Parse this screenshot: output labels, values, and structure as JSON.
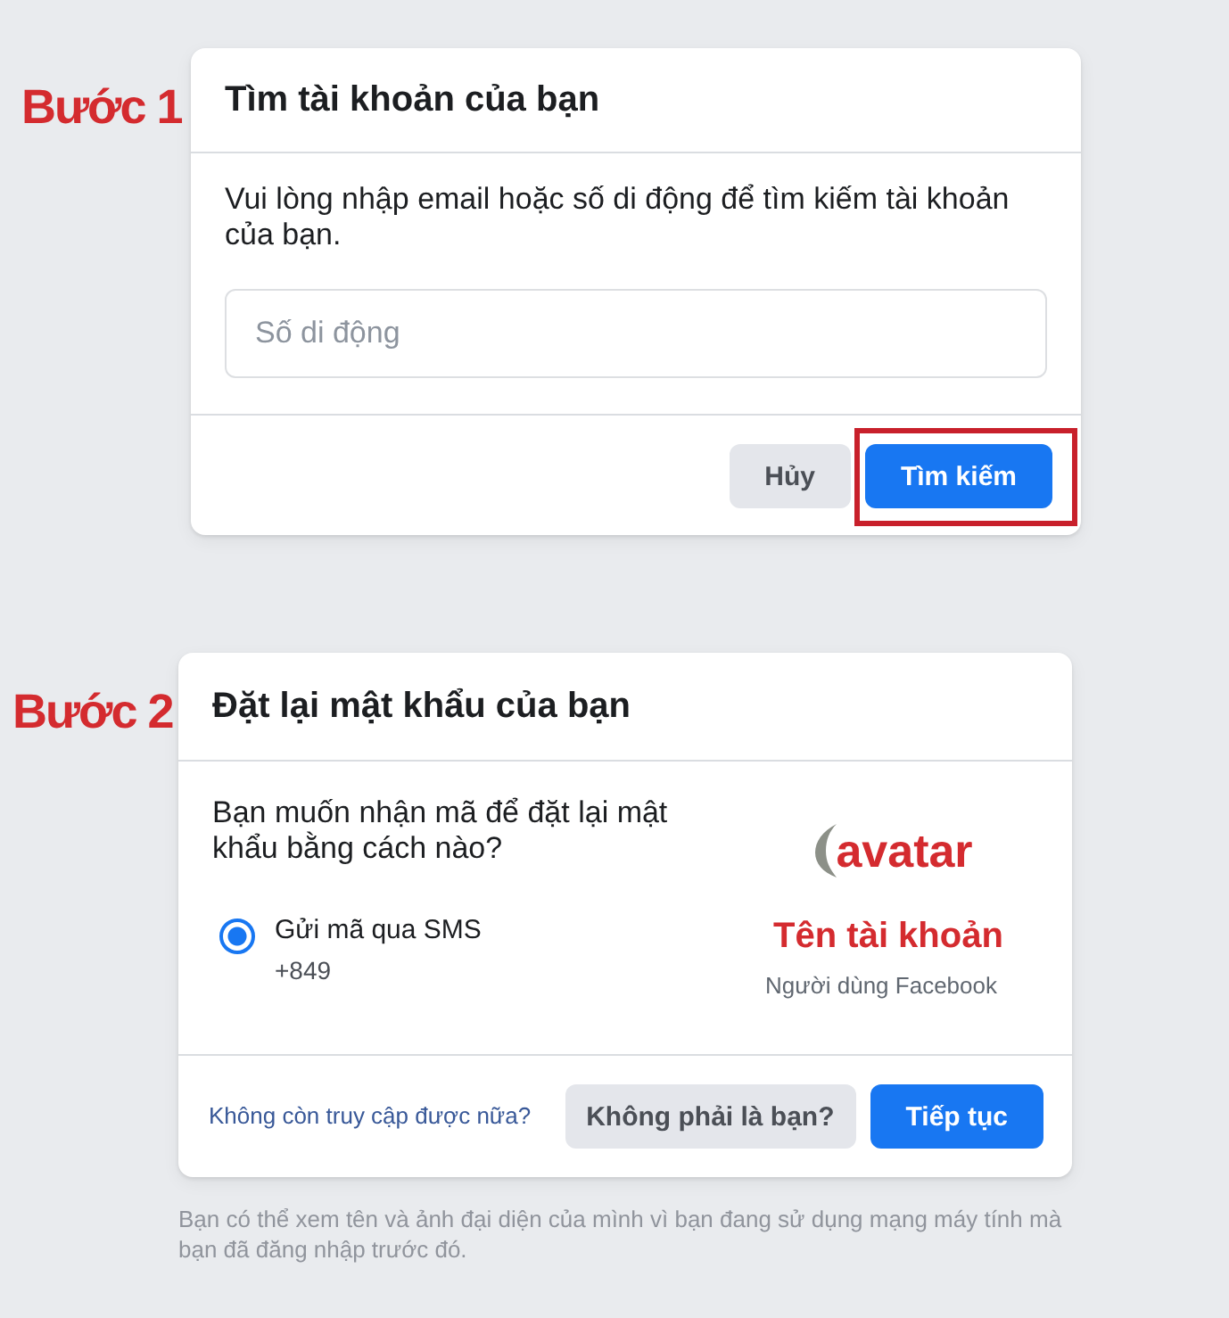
{
  "step_1": {
    "label": "Bước 1",
    "dialog": {
      "title": "Tìm tài khoản của bạn",
      "instructions": "Vui lòng nhập email hoặc số di động để tìm kiếm tài khoản của bạn.",
      "field": {
        "placeholder": "Số di động"
      },
      "buttons": [
        {
          "label": "Hủy",
          "kind": "secondary",
          "highlighted": false
        },
        {
          "label": "Tìm kiếm",
          "kind": "primary",
          "highlighted": true
        }
      ]
    }
  },
  "step_2": {
    "label": "Bước 2",
    "dialog": {
      "title": "Đặt lại mật khẩu của bạn",
      "question": "Bạn muốn nhận mã để đặt lại mật khẩu bằng cách nào?",
      "options": [
        {
          "label": "Gửi mã qua SMS",
          "detail": "+849",
          "selected": true
        }
      ],
      "account": {
        "photo_caption": "avatar",
        "name": "Tên tài khoản",
        "subtitle": "Người dùng Facebook"
      },
      "link": "Không còn truy cập được nữa?",
      "buttons": [
        {
          "label": "Không phải là bạn?",
          "kind": "secondary",
          "highlighted": false
        },
        {
          "label": "Tiếp tục",
          "kind": "primary",
          "highlighted": false
        }
      ]
    }
  },
  "footnote": "Bạn có thể xem tên và ảnh đại diện của mình vì bạn đang sử dụng mạng máy tính mà bạn đã đăng nhập trước đó."
}
